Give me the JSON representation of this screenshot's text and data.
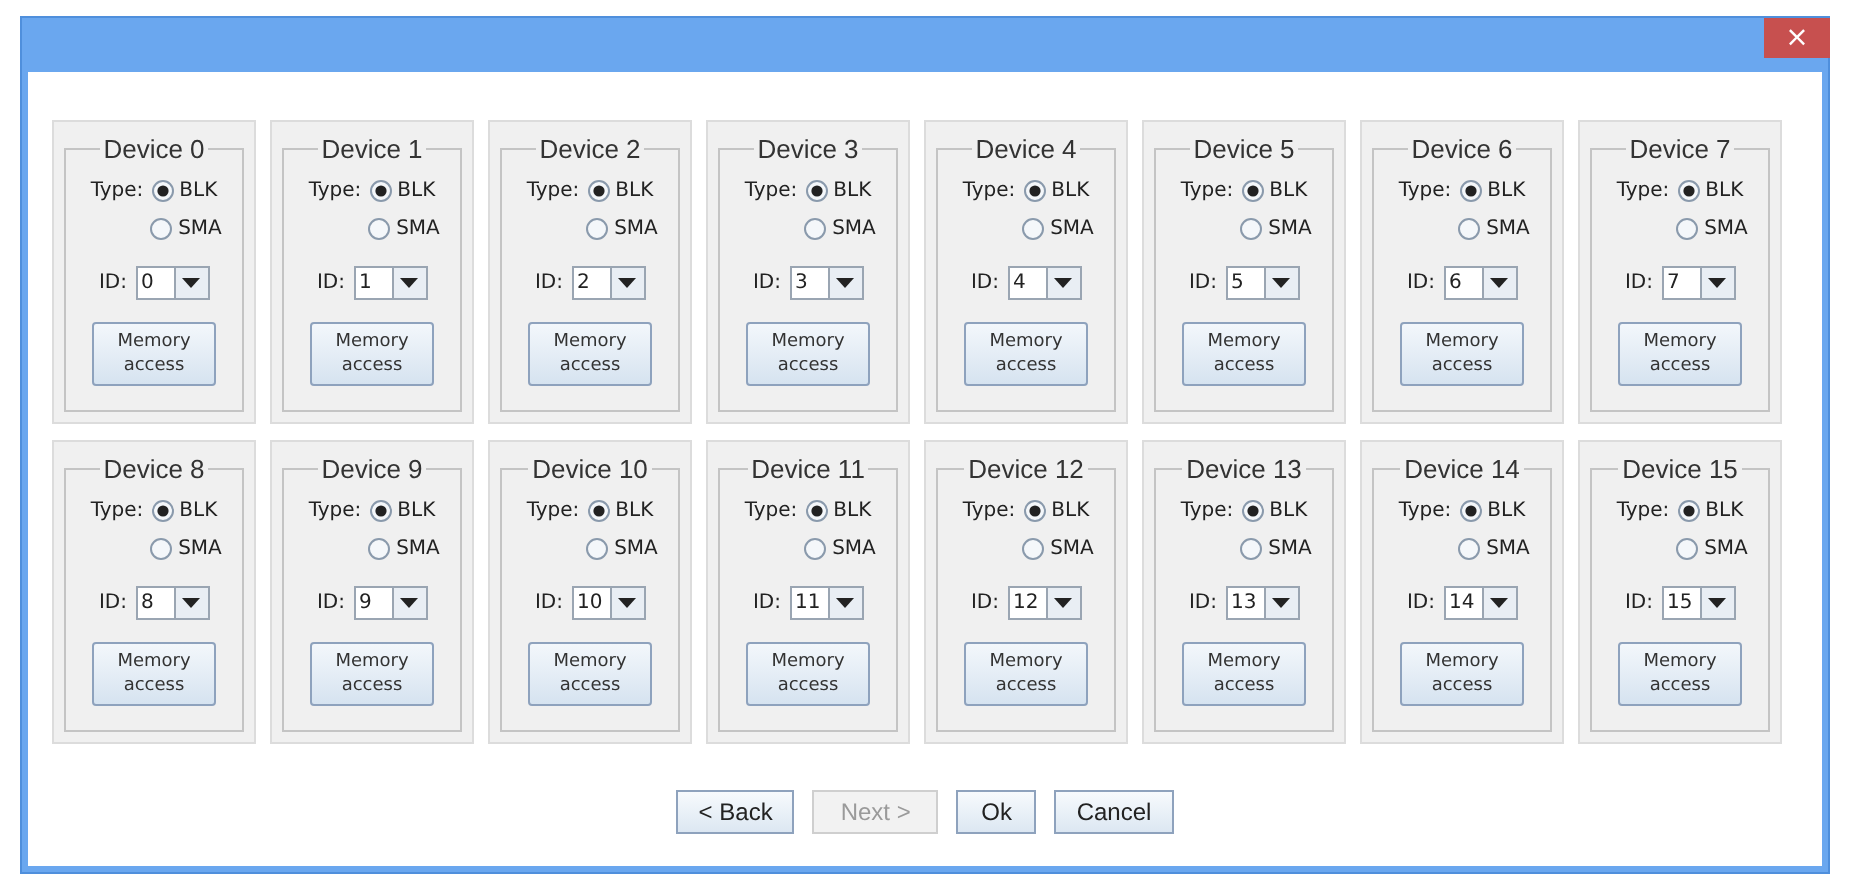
{
  "window": {
    "close": "×"
  },
  "devices": [
    {
      "title": "Device 0",
      "type_label": "Type:",
      "types": [
        {
          "label": "BLK",
          "selected": true
        },
        {
          "label": "SMA",
          "selected": false
        }
      ],
      "id_label": "ID:",
      "id": "0",
      "button": "Memory access"
    },
    {
      "title": "Device 1",
      "type_label": "Type:",
      "types": [
        {
          "label": "BLK",
          "selected": true
        },
        {
          "label": "SMA",
          "selected": false
        }
      ],
      "id_label": "ID:",
      "id": "1",
      "button": "Memory access"
    },
    {
      "title": "Device 2",
      "type_label": "Type:",
      "types": [
        {
          "label": "BLK",
          "selected": true
        },
        {
          "label": "SMA",
          "selected": false
        }
      ],
      "id_label": "ID:",
      "id": "2",
      "button": "Memory access"
    },
    {
      "title": "Device 3",
      "type_label": "Type:",
      "types": [
        {
          "label": "BLK",
          "selected": true
        },
        {
          "label": "SMA",
          "selected": false
        }
      ],
      "id_label": "ID:",
      "id": "3",
      "button": "Memory access"
    },
    {
      "title": "Device 4",
      "type_label": "Type:",
      "types": [
        {
          "label": "BLK",
          "selected": true
        },
        {
          "label": "SMA",
          "selected": false
        }
      ],
      "id_label": "ID:",
      "id": "4",
      "button": "Memory access"
    },
    {
      "title": "Device 5",
      "type_label": "Type:",
      "types": [
        {
          "label": "BLK",
          "selected": true
        },
        {
          "label": "SMA",
          "selected": false
        }
      ],
      "id_label": "ID:",
      "id": "5",
      "button": "Memory access"
    },
    {
      "title": "Device 6",
      "type_label": "Type:",
      "types": [
        {
          "label": "BLK",
          "selected": true
        },
        {
          "label": "SMA",
          "selected": false
        }
      ],
      "id_label": "ID:",
      "id": "6",
      "button": "Memory access"
    },
    {
      "title": "Device 7",
      "type_label": "Type:",
      "types": [
        {
          "label": "BLK",
          "selected": true
        },
        {
          "label": "SMA",
          "selected": false
        }
      ],
      "id_label": "ID:",
      "id": "7",
      "button": "Memory access"
    },
    {
      "title": "Device 8",
      "type_label": "Type:",
      "types": [
        {
          "label": "BLK",
          "selected": true
        },
        {
          "label": "SMA",
          "selected": false
        }
      ],
      "id_label": "ID:",
      "id": "8",
      "button": "Memory access"
    },
    {
      "title": "Device 9",
      "type_label": "Type:",
      "types": [
        {
          "label": "BLK",
          "selected": true
        },
        {
          "label": "SMA",
          "selected": false
        }
      ],
      "id_label": "ID:",
      "id": "9",
      "button": "Memory access"
    },
    {
      "title": "Device 10",
      "type_label": "Type:",
      "types": [
        {
          "label": "BLK",
          "selected": true
        },
        {
          "label": "SMA",
          "selected": false
        }
      ],
      "id_label": "ID:",
      "id": "10",
      "button": "Memory access"
    },
    {
      "title": "Device 11",
      "type_label": "Type:",
      "types": [
        {
          "label": "BLK",
          "selected": true
        },
        {
          "label": "SMA",
          "selected": false
        }
      ],
      "id_label": "ID:",
      "id": "11",
      "button": "Memory access"
    },
    {
      "title": "Device 12",
      "type_label": "Type:",
      "types": [
        {
          "label": "BLK",
          "selected": true
        },
        {
          "label": "SMA",
          "selected": false
        }
      ],
      "id_label": "ID:",
      "id": "12",
      "button": "Memory access"
    },
    {
      "title": "Device 13",
      "type_label": "Type:",
      "types": [
        {
          "label": "BLK",
          "selected": true
        },
        {
          "label": "SMA",
          "selected": false
        }
      ],
      "id_label": "ID:",
      "id": "13",
      "button": "Memory access"
    },
    {
      "title": "Device 14",
      "type_label": "Type:",
      "types": [
        {
          "label": "BLK",
          "selected": true
        },
        {
          "label": "SMA",
          "selected": false
        }
      ],
      "id_label": "ID:",
      "id": "14",
      "button": "Memory access"
    },
    {
      "title": "Device 15",
      "type_label": "Type:",
      "types": [
        {
          "label": "BLK",
          "selected": true
        },
        {
          "label": "SMA",
          "selected": false
        }
      ],
      "id_label": "ID:",
      "id": "15",
      "button": "Memory access"
    }
  ],
  "buttons": [
    {
      "label": "< Back",
      "disabled": false
    },
    {
      "label": "Next >",
      "disabled": true
    },
    {
      "label": "Ok",
      "disabled": false
    },
    {
      "label": "Cancel",
      "disabled": false
    }
  ]
}
